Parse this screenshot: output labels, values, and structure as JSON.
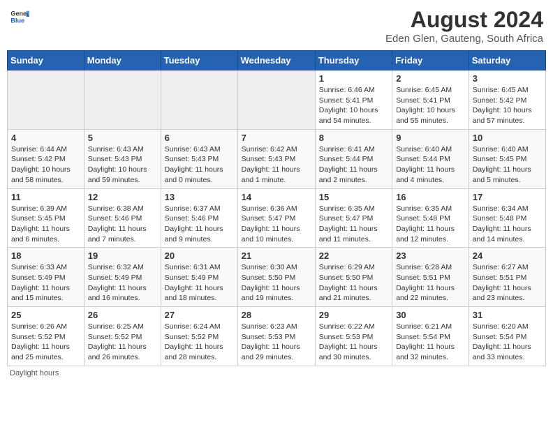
{
  "header": {
    "logo_general": "General",
    "logo_blue": "Blue",
    "title": "August 2024",
    "subtitle": "Eden Glen, Gauteng, South Africa"
  },
  "days_of_week": [
    "Sunday",
    "Monday",
    "Tuesday",
    "Wednesday",
    "Thursday",
    "Friday",
    "Saturday"
  ],
  "weeks": [
    [
      {
        "date": "",
        "info": ""
      },
      {
        "date": "",
        "info": ""
      },
      {
        "date": "",
        "info": ""
      },
      {
        "date": "",
        "info": ""
      },
      {
        "date": "1",
        "info": "Sunrise: 6:46 AM\nSunset: 5:41 PM\nDaylight: 10 hours and 54 minutes."
      },
      {
        "date": "2",
        "info": "Sunrise: 6:45 AM\nSunset: 5:41 PM\nDaylight: 10 hours and 55 minutes."
      },
      {
        "date": "3",
        "info": "Sunrise: 6:45 AM\nSunset: 5:42 PM\nDaylight: 10 hours and 57 minutes."
      }
    ],
    [
      {
        "date": "4",
        "info": "Sunrise: 6:44 AM\nSunset: 5:42 PM\nDaylight: 10 hours and 58 minutes."
      },
      {
        "date": "5",
        "info": "Sunrise: 6:43 AM\nSunset: 5:43 PM\nDaylight: 10 hours and 59 minutes."
      },
      {
        "date": "6",
        "info": "Sunrise: 6:43 AM\nSunset: 5:43 PM\nDaylight: 11 hours and 0 minutes."
      },
      {
        "date": "7",
        "info": "Sunrise: 6:42 AM\nSunset: 5:43 PM\nDaylight: 11 hours and 1 minute."
      },
      {
        "date": "8",
        "info": "Sunrise: 6:41 AM\nSunset: 5:44 PM\nDaylight: 11 hours and 2 minutes."
      },
      {
        "date": "9",
        "info": "Sunrise: 6:40 AM\nSunset: 5:44 PM\nDaylight: 11 hours and 4 minutes."
      },
      {
        "date": "10",
        "info": "Sunrise: 6:40 AM\nSunset: 5:45 PM\nDaylight: 11 hours and 5 minutes."
      }
    ],
    [
      {
        "date": "11",
        "info": "Sunrise: 6:39 AM\nSunset: 5:45 PM\nDaylight: 11 hours and 6 minutes."
      },
      {
        "date": "12",
        "info": "Sunrise: 6:38 AM\nSunset: 5:46 PM\nDaylight: 11 hours and 7 minutes."
      },
      {
        "date": "13",
        "info": "Sunrise: 6:37 AM\nSunset: 5:46 PM\nDaylight: 11 hours and 9 minutes."
      },
      {
        "date": "14",
        "info": "Sunrise: 6:36 AM\nSunset: 5:47 PM\nDaylight: 11 hours and 10 minutes."
      },
      {
        "date": "15",
        "info": "Sunrise: 6:35 AM\nSunset: 5:47 PM\nDaylight: 11 hours and 11 minutes."
      },
      {
        "date": "16",
        "info": "Sunrise: 6:35 AM\nSunset: 5:48 PM\nDaylight: 11 hours and 12 minutes."
      },
      {
        "date": "17",
        "info": "Sunrise: 6:34 AM\nSunset: 5:48 PM\nDaylight: 11 hours and 14 minutes."
      }
    ],
    [
      {
        "date": "18",
        "info": "Sunrise: 6:33 AM\nSunset: 5:49 PM\nDaylight: 11 hours and 15 minutes."
      },
      {
        "date": "19",
        "info": "Sunrise: 6:32 AM\nSunset: 5:49 PM\nDaylight: 11 hours and 16 minutes."
      },
      {
        "date": "20",
        "info": "Sunrise: 6:31 AM\nSunset: 5:49 PM\nDaylight: 11 hours and 18 minutes."
      },
      {
        "date": "21",
        "info": "Sunrise: 6:30 AM\nSunset: 5:50 PM\nDaylight: 11 hours and 19 minutes."
      },
      {
        "date": "22",
        "info": "Sunrise: 6:29 AM\nSunset: 5:50 PM\nDaylight: 11 hours and 21 minutes."
      },
      {
        "date": "23",
        "info": "Sunrise: 6:28 AM\nSunset: 5:51 PM\nDaylight: 11 hours and 22 minutes."
      },
      {
        "date": "24",
        "info": "Sunrise: 6:27 AM\nSunset: 5:51 PM\nDaylight: 11 hours and 23 minutes."
      }
    ],
    [
      {
        "date": "25",
        "info": "Sunrise: 6:26 AM\nSunset: 5:52 PM\nDaylight: 11 hours and 25 minutes."
      },
      {
        "date": "26",
        "info": "Sunrise: 6:25 AM\nSunset: 5:52 PM\nDaylight: 11 hours and 26 minutes."
      },
      {
        "date": "27",
        "info": "Sunrise: 6:24 AM\nSunset: 5:52 PM\nDaylight: 11 hours and 28 minutes."
      },
      {
        "date": "28",
        "info": "Sunrise: 6:23 AM\nSunset: 5:53 PM\nDaylight: 11 hours and 29 minutes."
      },
      {
        "date": "29",
        "info": "Sunrise: 6:22 AM\nSunset: 5:53 PM\nDaylight: 11 hours and 30 minutes."
      },
      {
        "date": "30",
        "info": "Sunrise: 6:21 AM\nSunset: 5:54 PM\nDaylight: 11 hours and 32 minutes."
      },
      {
        "date": "31",
        "info": "Sunrise: 6:20 AM\nSunset: 5:54 PM\nDaylight: 11 hours and 33 minutes."
      }
    ]
  ],
  "footer": {
    "daylight_label": "Daylight hours"
  }
}
